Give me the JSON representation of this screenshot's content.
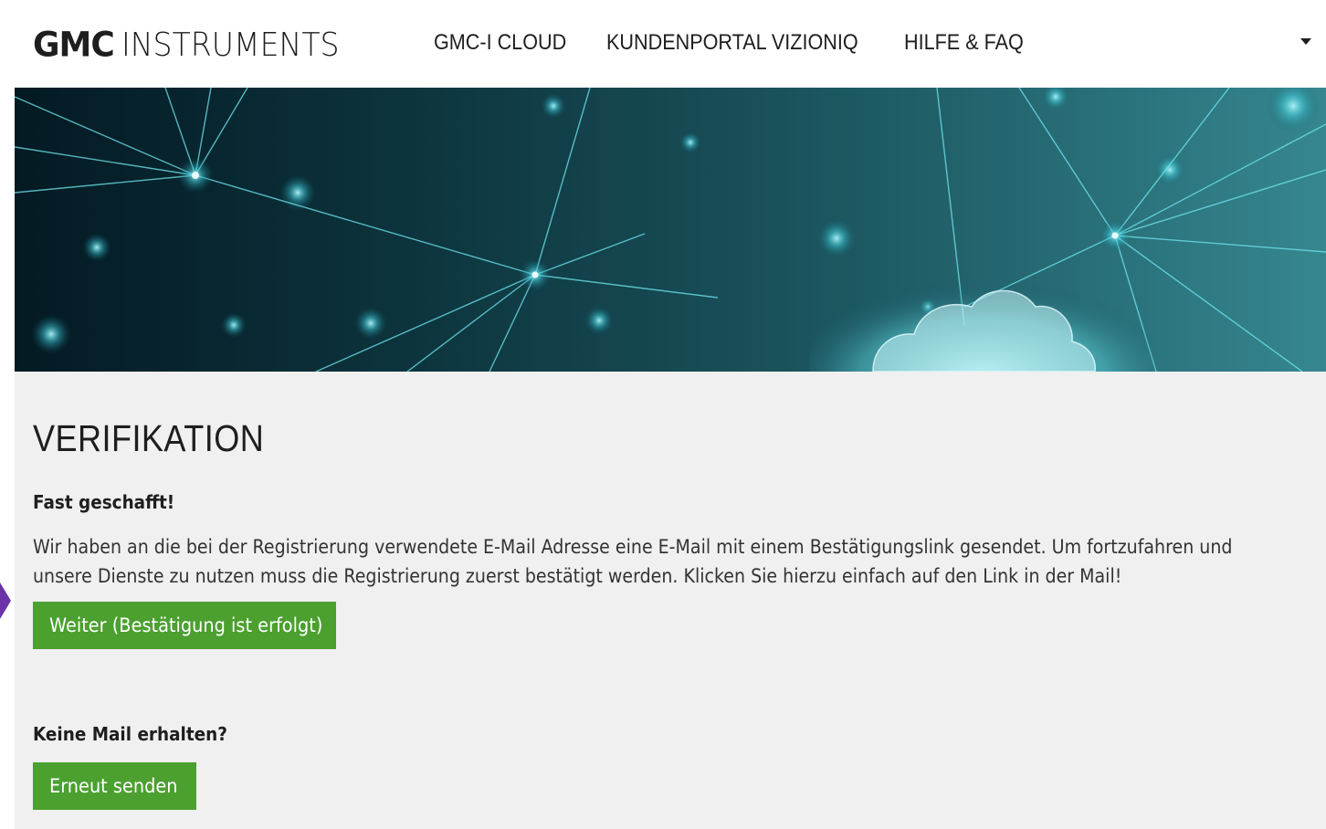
{
  "header": {
    "logo_bold": "GMC",
    "logo_light": "INSTRUMENTS",
    "nav": [
      {
        "label": "GMC-I CLOUD"
      },
      {
        "label": "KUNDENPORTAL VIZIONIQ"
      },
      {
        "label": "HILFE & FAQ"
      }
    ],
    "menu_caret": "chevron-down-icon"
  },
  "hero": {
    "image": "network-cloud-banner"
  },
  "main": {
    "title": "VERIFIKATION",
    "subhead_done": "Fast geschafft!",
    "message": "Wir haben an die bei der Registrierung verwendete E-Mail Adresse eine E-Mail mit einem Bestätigungslink gesendet. Um fortzufahren und unsere Dienste zu nutzen muss die Registrierung zuerst bestätigt werden. Klicken Sie hierzu einfach auf den Link in der Mail!",
    "continue_button": "Weiter (Bestätigung ist erfolgt)",
    "subhead_no_mail": "Keine Mail erhalten?",
    "resend_button": "Erneut senden"
  },
  "colors": {
    "button_green": "#4ba02f",
    "text_dark": "#1e1e1e",
    "content_bg": "#f0f0f0",
    "hero_cyan": "#5fe0e8"
  }
}
